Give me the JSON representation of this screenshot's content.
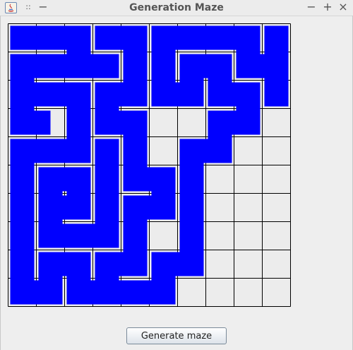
{
  "window": {
    "title": "Generation Maze",
    "controls": {
      "minimize": "−",
      "maximize": "+",
      "close": "×"
    },
    "menu_glyph": "−",
    "grip_glyph": "::"
  },
  "maze": {
    "cols": 10,
    "rows": 10,
    "fill_color": "#0000ff",
    "background_color": "#ececec",
    "grid_color": "#000000",
    "path_segments": [
      [
        [
          0,
          0
        ],
        [
          1,
          0
        ],
        [
          2,
          0
        ],
        [
          2,
          1
        ],
        [
          1,
          1
        ],
        [
          0,
          1
        ],
        [
          0,
          2
        ],
        [
          1,
          2
        ],
        [
          2,
          2
        ],
        [
          2,
          3
        ],
        [
          2,
          4
        ],
        [
          1,
          4
        ],
        [
          0,
          4
        ],
        [
          0,
          5
        ],
        [
          0,
          6
        ],
        [
          0,
          7
        ],
        [
          0,
          8
        ],
        [
          0,
          9
        ],
        [
          1,
          9
        ],
        [
          1,
          8
        ],
        [
          2,
          8
        ],
        [
          2,
          9
        ],
        [
          3,
          9
        ],
        [
          4,
          9
        ],
        [
          5,
          9
        ],
        [
          5,
          8
        ],
        [
          6,
          8
        ],
        [
          6,
          7
        ],
        [
          6,
          6
        ],
        [
          6,
          5
        ],
        [
          6,
          4
        ],
        [
          7,
          4
        ],
        [
          7,
          3
        ],
        [
          8,
          3
        ],
        [
          8,
          2
        ],
        [
          7,
          2
        ],
        [
          7,
          1
        ],
        [
          6,
          1
        ],
        [
          6,
          2
        ],
        [
          5,
          2
        ],
        [
          5,
          1
        ],
        [
          5,
          0
        ],
        [
          6,
          0
        ],
        [
          7,
          0
        ],
        [
          8,
          0
        ],
        [
          8,
          1
        ],
        [
          9,
          1
        ],
        [
          9,
          2
        ]
      ],
      [
        [
          3,
          0
        ],
        [
          4,
          0
        ],
        [
          4,
          1
        ],
        [
          4,
          2
        ],
        [
          3,
          2
        ],
        [
          3,
          3
        ],
        [
          4,
          3
        ],
        [
          4,
          4
        ],
        [
          4,
          5
        ],
        [
          5,
          5
        ],
        [
          5,
          6
        ],
        [
          4,
          6
        ],
        [
          4,
          7
        ],
        [
          4,
          8
        ],
        [
          3,
          8
        ],
        [
          3,
          9
        ]
      ],
      [
        [
          9,
          0
        ],
        [
          9,
          1
        ]
      ],
      [
        [
          3,
          1
        ],
        [
          2,
          1
        ]
      ],
      [
        [
          0,
          3
        ],
        [
          1,
          3
        ],
        [
          0,
          3
        ],
        [
          0,
          2
        ]
      ],
      [
        [
          1,
          5
        ],
        [
          2,
          5
        ],
        [
          2,
          6
        ],
        [
          1,
          6
        ],
        [
          1,
          5
        ]
      ],
      [
        [
          1,
          5
        ],
        [
          1,
          6
        ],
        [
          1,
          7
        ],
        [
          2,
          7
        ],
        [
          3,
          7
        ],
        [
          3,
          6
        ],
        [
          3,
          5
        ],
        [
          3,
          4
        ]
      ]
    ]
  },
  "button": {
    "label": "Generate maze"
  }
}
